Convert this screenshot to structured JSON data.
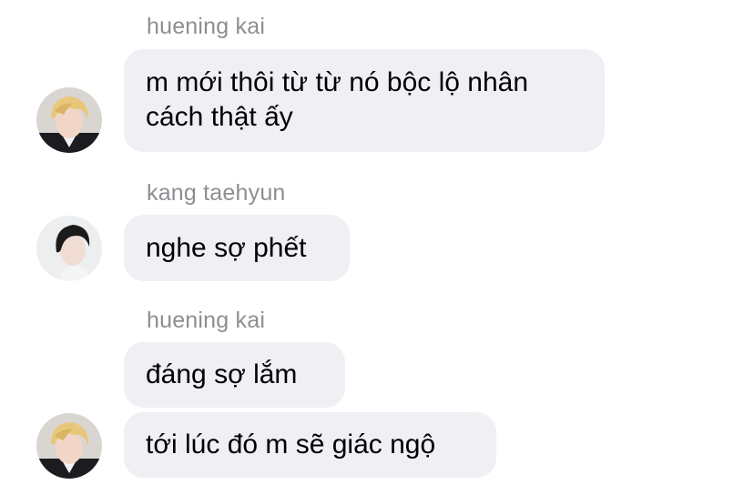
{
  "messages": [
    {
      "sender": "huening kai",
      "avatar": "huening-kai-avatar",
      "bubbles": [
        "m mới thôi từ từ nó bộc lộ nhân cách thật ấy"
      ]
    },
    {
      "sender": "kang taehyun",
      "avatar": "kang-taehyun-avatar",
      "bubbles": [
        "nghe sợ phết"
      ]
    },
    {
      "sender": "huening kai",
      "avatar": "huening-kai-avatar",
      "bubbles": [
        "đáng sợ lắm",
        "tới lúc đó m sẽ giác ngộ"
      ]
    }
  ],
  "colors": {
    "bubble_background": "#efeff4",
    "sender_name": "#8e8e93",
    "message_text": "#000000"
  }
}
